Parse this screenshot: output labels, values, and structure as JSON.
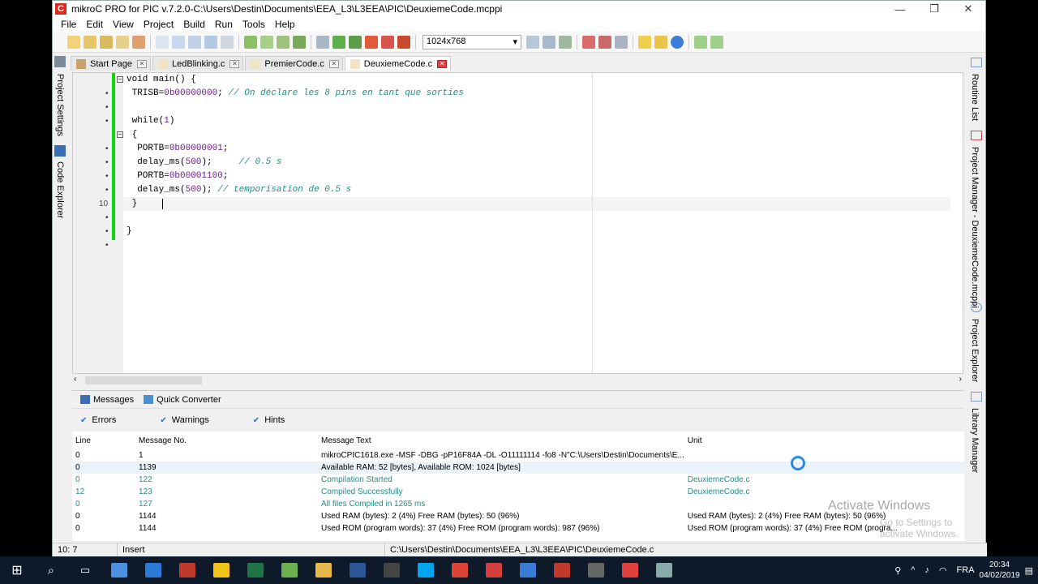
{
  "window": {
    "title": "mikroC PRO for PIC v.7.2.0-C:\\Users\\Destin\\Documents\\EEA_L3\\L3EEA\\PIC\\DeuxiemeCode.mcppi",
    "controls": {
      "minimize": "—",
      "restore": "❐",
      "close": "✕"
    }
  },
  "menu": [
    "File",
    "Edit",
    "View",
    "Project",
    "Build",
    "Run",
    "Tools",
    "Help"
  ],
  "toolbar": {
    "resolution": "1024x768"
  },
  "tabs": [
    {
      "label": "Start Page",
      "active": false
    },
    {
      "label": "LedBlinking.c",
      "active": false
    },
    {
      "label": "PremierCode.c",
      "active": false
    },
    {
      "label": "DeuxiemeCode.c",
      "active": true
    }
  ],
  "left_dock": {
    "project_settings": "Project Settings",
    "code_explorer": "Code Explorer"
  },
  "right_dock": {
    "routine_list": "Routine List",
    "project_manager": "Project Manager - DeuxiemeCode.mcppi",
    "project_explorer": "Project Explorer",
    "library_manager": "Library Manager"
  },
  "code": [
    {
      "pre": "",
      "kw": "void main() {",
      "cm": ""
    },
    {
      "pre": " ",
      "kw": "TRISB=",
      "num": "0b00000000",
      "kw2": "; ",
      "cm": "// On déclare les 8 pins en tant que sorties"
    },
    {
      "pre": "",
      "kw": "",
      "cm": ""
    },
    {
      "pre": " ",
      "kw": "while(",
      "num": "1",
      "kw2": ")",
      "cm": ""
    },
    {
      "pre": " ",
      "kw": "{",
      "cm": ""
    },
    {
      "pre": "  ",
      "kw": "PORTB=",
      "num": "0b00000001",
      "kw2": ";",
      "cm": ""
    },
    {
      "pre": "  ",
      "kw": "delay_ms(",
      "num": "500",
      "kw2": ");     ",
      "cm": "// 0.5 s"
    },
    {
      "pre": "  ",
      "kw": "PORTB=",
      "num": "0b00001100",
      "kw2": ";",
      "cm": ""
    },
    {
      "pre": "  ",
      "kw": "delay_ms(",
      "num": "500",
      "kw2": "); ",
      "cm": "// temporisation de 0.5 s"
    },
    {
      "pre": " ",
      "kw": "}    ",
      "cm": ""
    },
    {
      "pre": "",
      "kw": "",
      "cm": ""
    },
    {
      "pre": "",
      "kw": "}",
      "cm": ""
    }
  ],
  "line_number_shown": "10",
  "messages": {
    "tabs": [
      "Messages",
      "Quick Converter"
    ],
    "filters": [
      "Errors",
      "Warnings",
      "Hints"
    ],
    "columns": [
      "Line",
      "Message No.",
      "Message Text",
      "Unit"
    ],
    "rows": [
      {
        "line": "0",
        "no": "1",
        "text": "mikroCPIC1618.exe -MSF -DBG -pP16F84A -DL -O11111114 -fo8 -N\"C:\\Users\\Destin\\Documents\\E...",
        "unit": "",
        "kind": "info"
      },
      {
        "line": "0",
        "no": "1139",
        "text": "Available RAM: 52 [bytes], Available ROM: 1024 [bytes]",
        "unit": "",
        "kind": "info sel"
      },
      {
        "line": "0",
        "no": "122",
        "text": "Compilation Started",
        "unit": "DeuxiemeCode.c",
        "kind": "ok"
      },
      {
        "line": "12",
        "no": "123",
        "text": "Compiled Successfully",
        "unit": "DeuxiemeCode.c",
        "kind": "ok"
      },
      {
        "line": "0",
        "no": "127",
        "text": "All files Compiled in 1265 ms",
        "unit": "",
        "kind": "ok"
      },
      {
        "line": "0",
        "no": "1144",
        "text": "Used RAM (bytes): 2 (4%)  Free RAM (bytes): 50 (96%)",
        "unit": "Used RAM (bytes): 2 (4%)  Free RAM (bytes): 50 (96%)",
        "kind": "info"
      },
      {
        "line": "0",
        "no": "1144",
        "text": "Used ROM (program words): 37 (4%)  Free ROM (program words): 987 (96%)",
        "unit": "Used ROM (program words): 37 (4%)  Free ROM (progra...",
        "kind": "info"
      }
    ]
  },
  "status": {
    "position": "10: 7",
    "mode": "Insert",
    "path": "C:\\Users\\Destin\\Documents\\EEA_L3\\L3EEA\\PIC\\DeuxiemeCode.c"
  },
  "watermark": {
    "line1": "Activate Windows",
    "line2": "Go to Settings to activate Windows."
  },
  "taskbar": {
    "lang": "FRA",
    "time": "20:34",
    "date": "04/02/2019",
    "icon_colors": [
      "#4a8fe0",
      "#2b7bd6",
      "#c0392b",
      "#f0c419",
      "#217346",
      "#6ab04c",
      "#e8b84a",
      "#2b5797",
      "#444444",
      "#00a4ef",
      "#db4437",
      "#d33f3f",
      "#3a7bd5",
      "#c0392b",
      "#666666",
      "#e04040",
      "#8aa"
    ]
  }
}
